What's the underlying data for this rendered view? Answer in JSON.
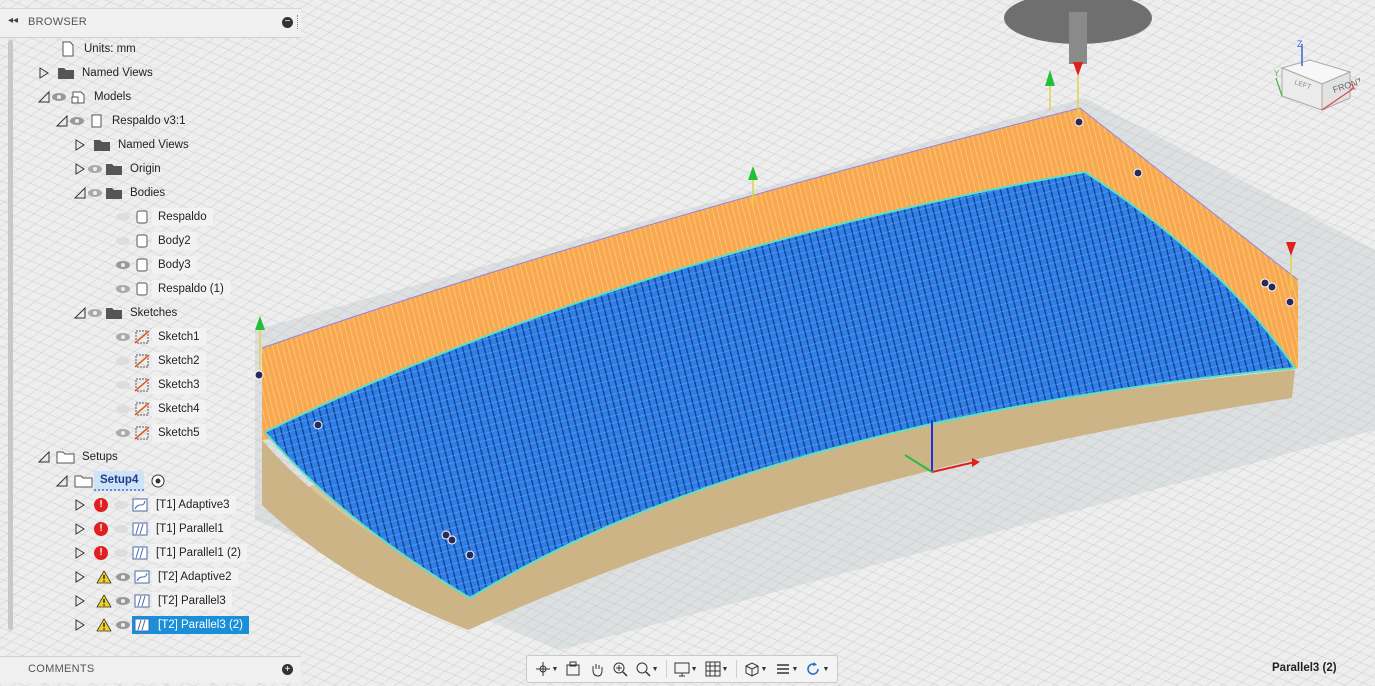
{
  "browser": {
    "title": "BROWSER",
    "tree": [
      {
        "label": "Units: mm"
      },
      {
        "label": "Named Views"
      },
      {
        "label": "Models"
      },
      {
        "label": "Respaldo v3:1"
      },
      {
        "label": "Named Views"
      },
      {
        "label": "Origin"
      },
      {
        "label": "Bodies"
      },
      {
        "label": "Respaldo"
      },
      {
        "label": "Body2"
      },
      {
        "label": "Body3"
      },
      {
        "label": "Respaldo (1)"
      },
      {
        "label": "Sketches"
      },
      {
        "label": "Sketch1"
      },
      {
        "label": "Sketch2"
      },
      {
        "label": "Sketch3"
      },
      {
        "label": "Sketch4"
      },
      {
        "label": "Sketch5"
      },
      {
        "label": "Setups"
      },
      {
        "label": "Setup4"
      },
      {
        "label": "[T1] Adaptive3",
        "status": "error"
      },
      {
        "label": "[T1] Parallel1",
        "status": "error"
      },
      {
        "label": "[T1] Parallel1 (2)",
        "status": "error"
      },
      {
        "label": "[T2] Adaptive2",
        "status": "warning"
      },
      {
        "label": "[T2] Parallel3",
        "status": "warning"
      },
      {
        "label": "[T2] Parallel3 (2)",
        "status": "warning",
        "selected": true
      }
    ]
  },
  "comments": {
    "title": "COMMENTS"
  },
  "statusbar": {
    "selection": "Parallel3 (2)"
  },
  "viewcube": {
    "front": "FRONT",
    "left": "LEFT",
    "axis_z": "Z",
    "axis_x": "X",
    "axis_y": "Y"
  },
  "colors": {
    "stock": "#f7a54a",
    "toolpath": "#2d86f0",
    "part": "#d9c49e",
    "selected": "#1a8fd8",
    "error": "#e02020",
    "warning": "#f2d21b"
  },
  "icons": [
    "collapse-icon",
    "document-icon",
    "folder-icon",
    "eye-icon",
    "component-icon",
    "body-icon",
    "sketch-icon",
    "setup-icon",
    "operation-icon",
    "error-icon",
    "warning-icon",
    "orbit-icon",
    "pan-icon",
    "zoom-icon",
    "display-icon",
    "grid-icon"
  ]
}
